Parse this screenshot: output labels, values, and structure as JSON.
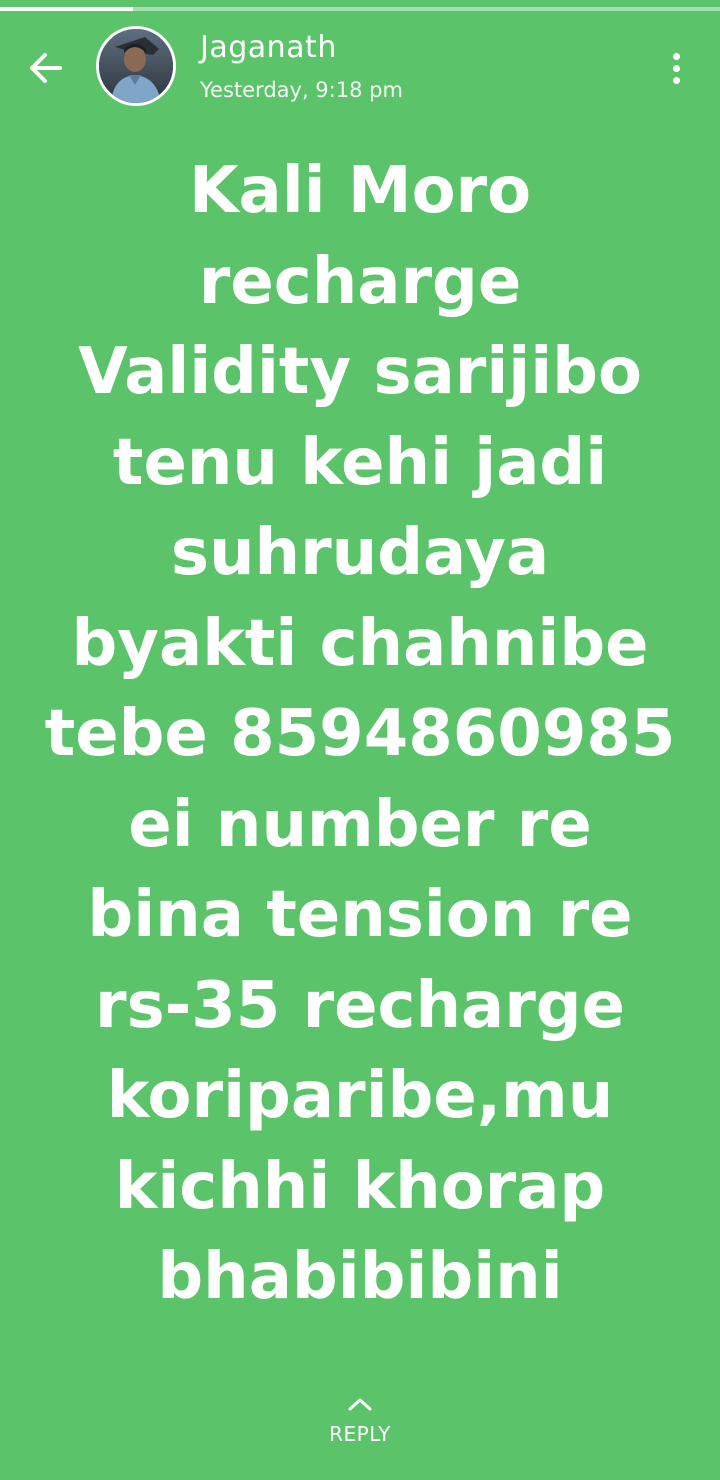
{
  "theme": {
    "background": "#5bc46a",
    "foreground": "#ffffff"
  },
  "status_viewer": {
    "progress": 0.185,
    "header": {
      "back_icon": "arrow-left-icon",
      "author_name": "Jaganath",
      "timestamp": "Yesterday, 9:18 pm",
      "menu_icon": "more-vertical-icon"
    },
    "status_text": "Kali Moro\nrecharge\nValidity sarijibo\ntenu kehi jadi\nsuhrudaya\nbyakti chahnibe\ntebe 8594860985\nei number re\nbina tension re\nrs-35 recharge\nkoriparibe,mu\nkichhi khorap\nbhabibibini",
    "footer": {
      "reply_icon": "chevron-up-icon",
      "reply_label": "REPLY"
    }
  }
}
